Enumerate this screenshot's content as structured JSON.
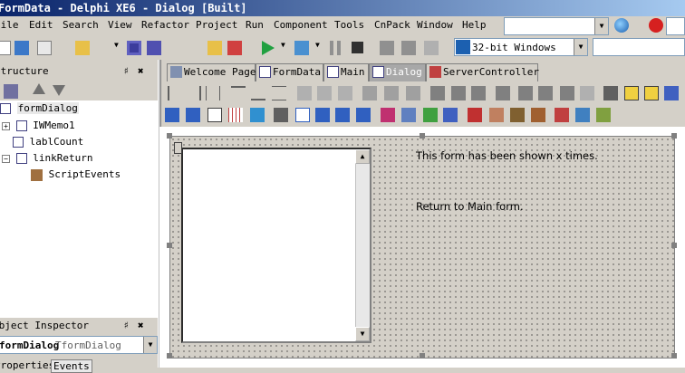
{
  "window": {
    "title": "FormData - Delphi XE6 - Dialog [Built]"
  },
  "menu": [
    "File",
    "Edit",
    "Search",
    "View",
    "Refactor",
    "Project",
    "Run",
    "Component",
    "Tools",
    "CnPack",
    "Window",
    "Help"
  ],
  "toolbar": {
    "platform": "32-bit Windows"
  },
  "structure": {
    "title": "Structure",
    "items": [
      "formDialog",
      "IWMemo1",
      "lablCount",
      "linkReturn",
      "ScriptEvents"
    ]
  },
  "inspector": {
    "title": "Object Inspector",
    "component": "formDialog",
    "type": "TformDialog",
    "tabs": [
      "Properties",
      "Events"
    ]
  },
  "tabs": [
    "Welcome Page",
    "FormData",
    "Main",
    "Dialog",
    "ServerController"
  ],
  "form": {
    "label_count": "This form has been shown x times.",
    "link_return": "Return to Main form."
  }
}
